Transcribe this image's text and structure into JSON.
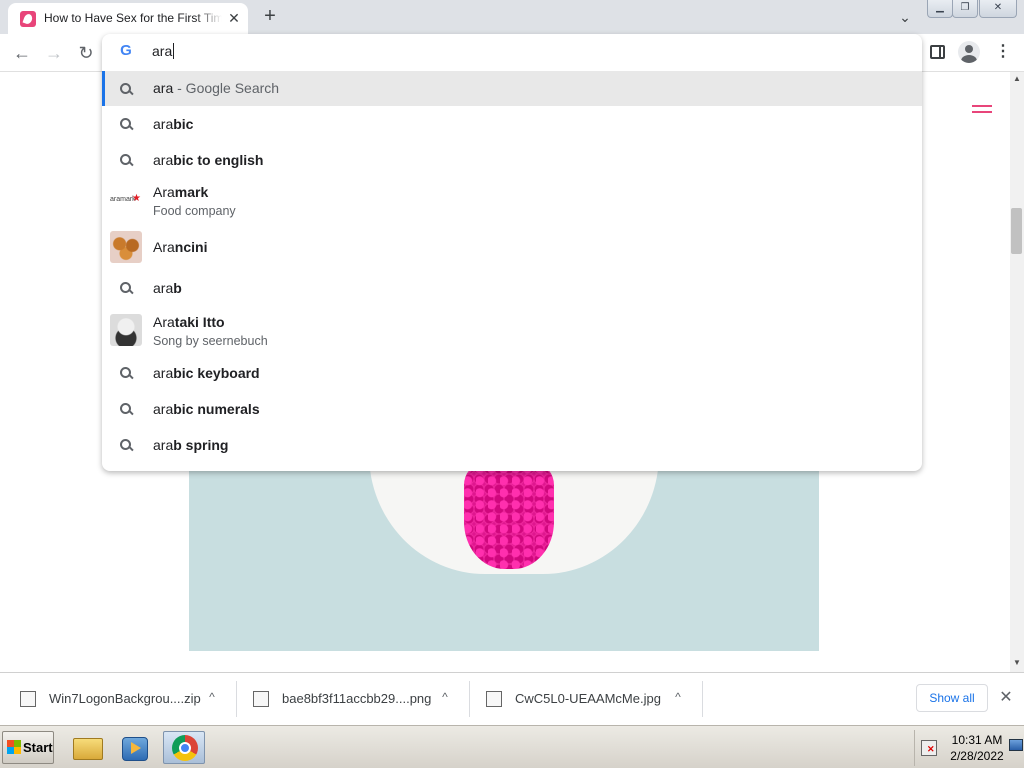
{
  "tab": {
    "title": "How to Have Sex for the First Time"
  },
  "omnibox": {
    "query": "ara",
    "g_icon": "G"
  },
  "suggestions": [
    {
      "prefix": "ara",
      "rest": "",
      "engine": " - Google Search",
      "icon": "search-icon",
      "sub": ""
    },
    {
      "prefix": "ara",
      "rest": "bic",
      "engine": "",
      "icon": "search-icon",
      "sub": ""
    },
    {
      "prefix": "ara",
      "rest": "bic to english",
      "engine": "",
      "icon": "search-icon",
      "sub": ""
    },
    {
      "prefix": "Ara",
      "rest": "mark",
      "engine": "",
      "icon": "aramark-logo",
      "sub": "Food company"
    },
    {
      "prefix": "Ara",
      "rest": "ncini",
      "engine": "",
      "icon": "arancini-thumbnail",
      "sub": ""
    },
    {
      "prefix": "ara",
      "rest": "b",
      "engine": "",
      "icon": "search-icon",
      "sub": ""
    },
    {
      "prefix": "Ara",
      "rest": "taki Itto",
      "engine": "",
      "icon": "arataki-itto-thumbnail",
      "sub": "Song by seernebuch"
    },
    {
      "prefix": "ara",
      "rest": "bic keyboard",
      "engine": "",
      "icon": "search-icon",
      "sub": ""
    },
    {
      "prefix": "ara",
      "rest": "bic numerals",
      "engine": "",
      "icon": "search-icon",
      "sub": ""
    },
    {
      "prefix": "ara",
      "rest": "b spring",
      "engine": "",
      "icon": "search-icon",
      "sub": ""
    }
  ],
  "downloads": {
    "items": [
      {
        "name": "Win7LogonBackgrou....zip"
      },
      {
        "name": "bae8bf3f11accbb29....png"
      },
      {
        "name": "CwC5L0-UEAAMcMe.jpg"
      }
    ],
    "show_all": "Show all"
  },
  "taskbar": {
    "start_label": "Start",
    "time": "10:31 AM",
    "date": "2/28/2022"
  },
  "colors": {
    "accent": "#1a73e8",
    "site_brand": "#e8457a",
    "selected_row": "#e8e8e8"
  }
}
